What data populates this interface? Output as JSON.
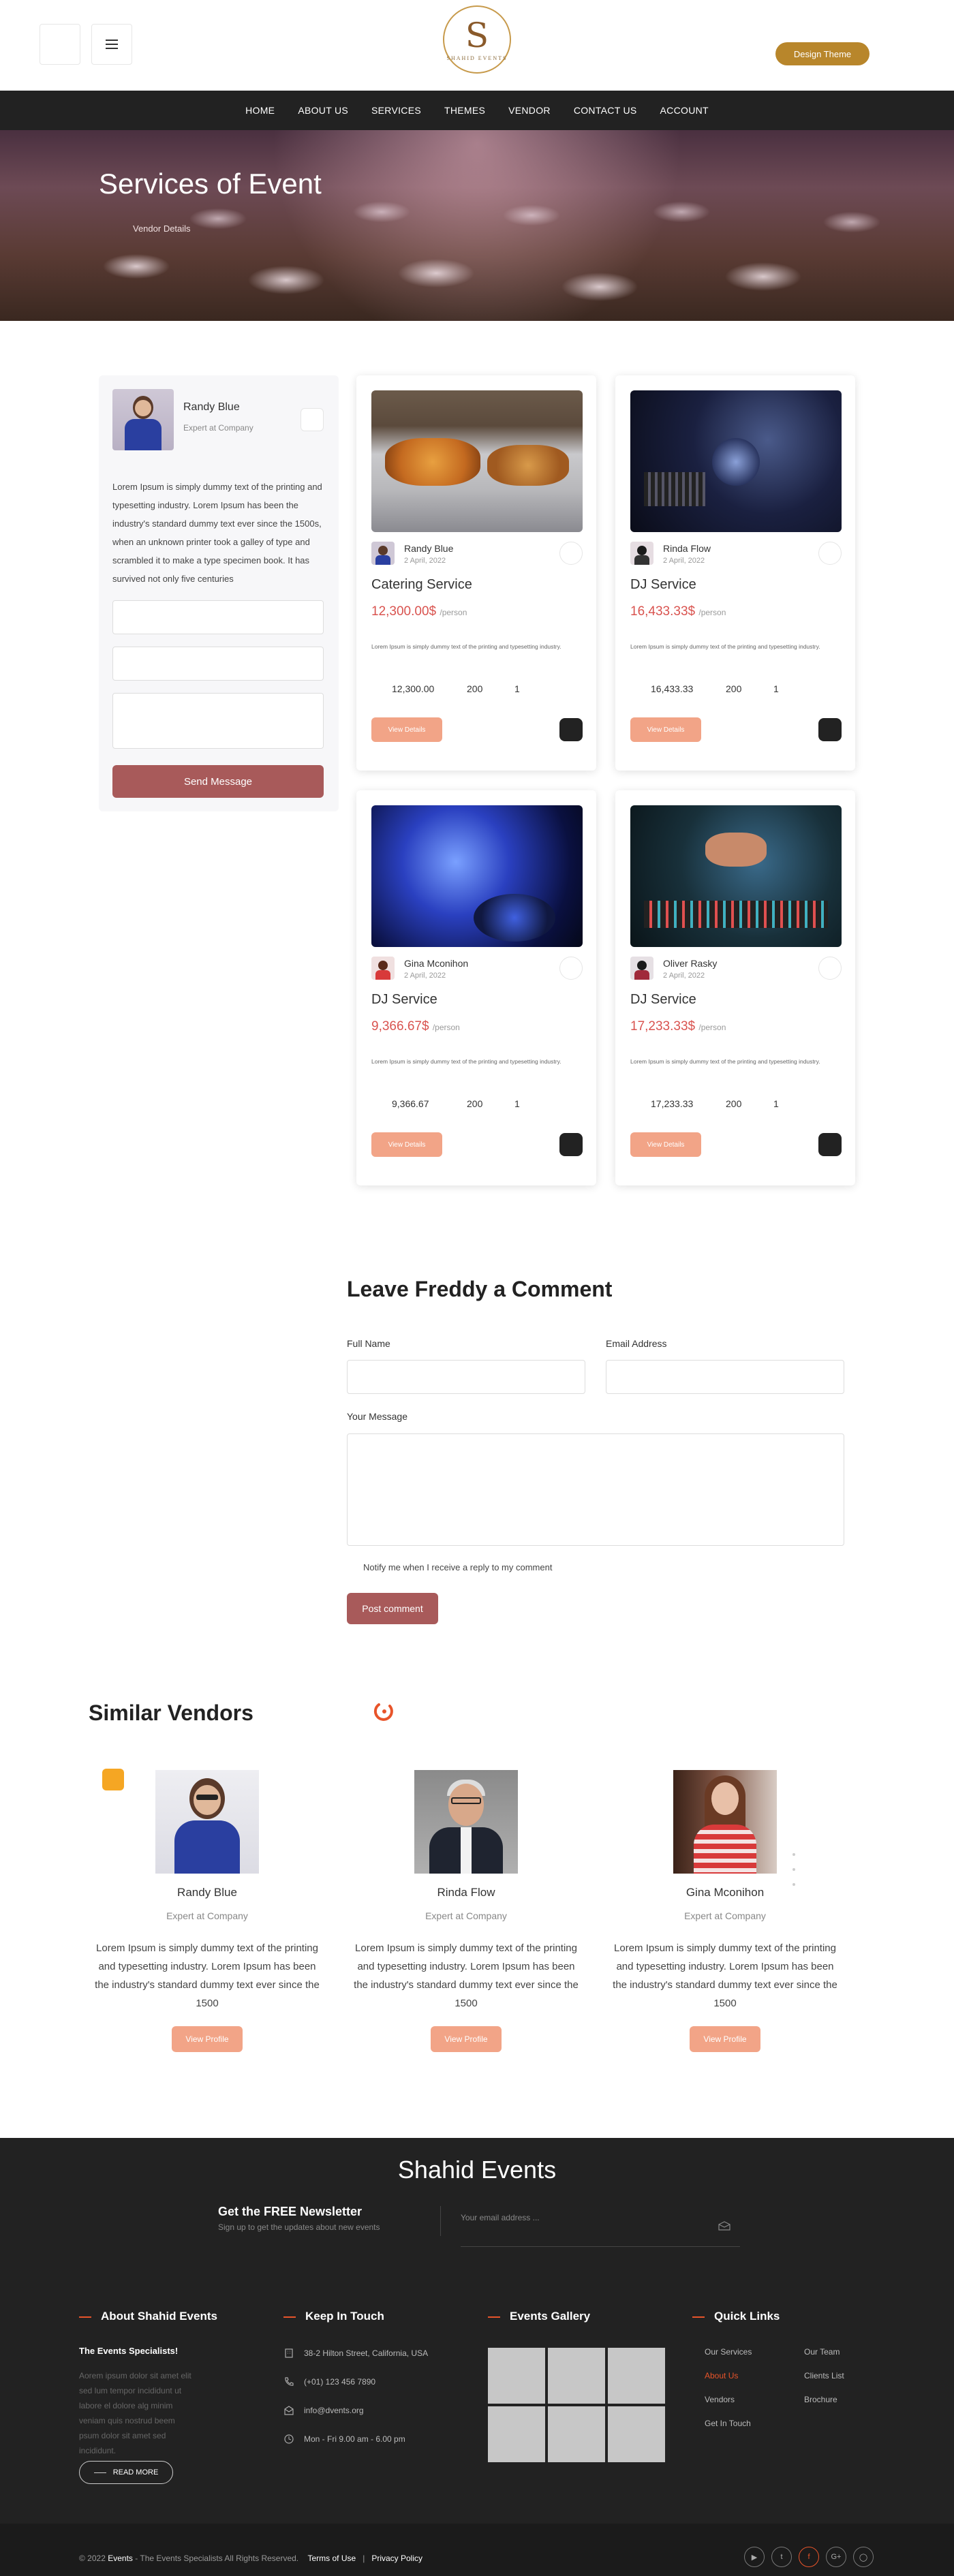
{
  "header": {
    "logo_letter": "S",
    "logo_text": "SHAHID EVENTS",
    "theme_button": "Design Theme"
  },
  "nav": [
    "HOME",
    "ABOUT US",
    "SERVICES",
    "THEMES",
    "VENDOR",
    "CONTACT US",
    "ACCOUNT"
  ],
  "hero": {
    "title": "Services of Event",
    "subtitle": "Vendor Details"
  },
  "sidebar": {
    "name": "Randy Blue",
    "role": "Expert at Company",
    "bio": "Lorem Ipsum is simply dummy text of the printing and typesetting industry. Lorem Ipsum has been the industry's standard dummy text ever since the 1500s, when an unknown printer took a galley of type and scrambled it to make a type specimen book. It has survived not only five centuries",
    "send_button": "Send Message"
  },
  "services": [
    {
      "vendor": "Randy Blue",
      "date": "2 April, 2022",
      "title": "Catering Service",
      "price": "12,300.00$",
      "per": "/person",
      "desc": "Lorem Ipsum is simply dummy text of the printing and typesetting industry.",
      "stat1": "12,300.00",
      "stat2": "200",
      "stat3": "1",
      "button": "View Details"
    },
    {
      "vendor": "Rinda Flow",
      "date": "2 April, 2022",
      "title": "DJ Service",
      "price": "16,433.33$",
      "per": "/person",
      "desc": "Lorem Ipsum is simply dummy text of the printing and typesetting industry.",
      "stat1": "16,433.33",
      "stat2": "200",
      "stat3": "1",
      "button": "View Details"
    },
    {
      "vendor": "Gina Mconihon",
      "date": "2 April, 2022",
      "title": "DJ Service",
      "price": "9,366.67$",
      "per": "/person",
      "desc": "Lorem Ipsum is simply dummy text of the printing and typesetting industry.",
      "stat1": "9,366.67",
      "stat2": "200",
      "stat3": "1",
      "button": "View Details"
    },
    {
      "vendor": "Oliver Rasky",
      "date": "2 April, 2022",
      "title": "DJ Service",
      "price": "17,233.33$",
      "per": "/person",
      "desc": "Lorem Ipsum is simply dummy text of the printing and typesetting industry.",
      "stat1": "17,233.33",
      "stat2": "200",
      "stat3": "1",
      "button": "View Details"
    }
  ],
  "comment": {
    "title": "Leave Freddy a Comment",
    "full_name_label": "Full Name",
    "email_label": "Email Address",
    "message_label": "Your Message",
    "notify": "Notify me when I receive a reply to my comment",
    "post_button": "Post comment"
  },
  "similar": {
    "title": "Similar Vendors",
    "vendors": [
      {
        "name": "Randy Blue",
        "role": "Expert at Company",
        "desc": "Lorem Ipsum is simply dummy text of the printing and typesetting industry. Lorem Ipsum has been the industry's standard dummy text ever since the 1500",
        "button": "View Profile"
      },
      {
        "name": "Rinda Flow",
        "role": "Expert at Company",
        "desc": "Lorem Ipsum is simply dummy text of the printing and typesetting industry. Lorem Ipsum has been the industry's standard dummy text ever since the 1500",
        "button": "View Profile"
      },
      {
        "name": "Gina Mconihon",
        "role": "Expert at Company",
        "desc": "Lorem Ipsum is simply dummy text of the printing and typesetting industry. Lorem Ipsum has been the industry's standard dummy text ever since the 1500",
        "button": "View Profile"
      }
    ]
  },
  "footer": {
    "brand": "Shahid Events",
    "newsletter_title": "Get the FREE Newsletter",
    "newsletter_sub": "Sign up to get the updates about new events",
    "email_placeholder": "Your email address ...",
    "about_heading": "About Shahid Events",
    "about_title": "The Events Specialists!",
    "about_text": "Aorem ipsum dolor sit amet elit sed lum tempor incididunt ut labore el dolore alg minim veniam quis nostrud beem psum dolor sit amet sed incididunt.",
    "read_more": "READ MORE",
    "touch_heading": "Keep In Touch",
    "address": "38-2 Hilton Street, California, USA",
    "phone": "(+01) 123 456 7890",
    "email": "info@dvents.org",
    "hours": "Mon - Fri 9.00 am - 6.00 pm",
    "gallery_heading": "Events Gallery",
    "links_heading": "Quick Links",
    "links_col1": [
      "Our Services",
      "About Us",
      "Vendors",
      "Get In Touch"
    ],
    "links_col2": [
      "Our Team",
      "Clients List",
      "Brochure"
    ],
    "copyright_prefix": "© 2022",
    "copyright_brand": "Events",
    "copyright_suffix": "- The Events Specialists All Rights Reserved.",
    "terms": "Terms of Use",
    "separator": "|",
    "privacy": "Privacy Policy",
    "social": [
      "youtube-icon",
      "twitter-icon",
      "facebook-icon",
      "google-plus-icon",
      "instagram-icon"
    ]
  },
  "colors": {
    "accent": "#e8542a",
    "brand_gold": "#b8862b",
    "button_rose": "#a85a5a",
    "button_peach": "#f2a487",
    "price_red": "#d9534f",
    "dark": "#222222"
  }
}
